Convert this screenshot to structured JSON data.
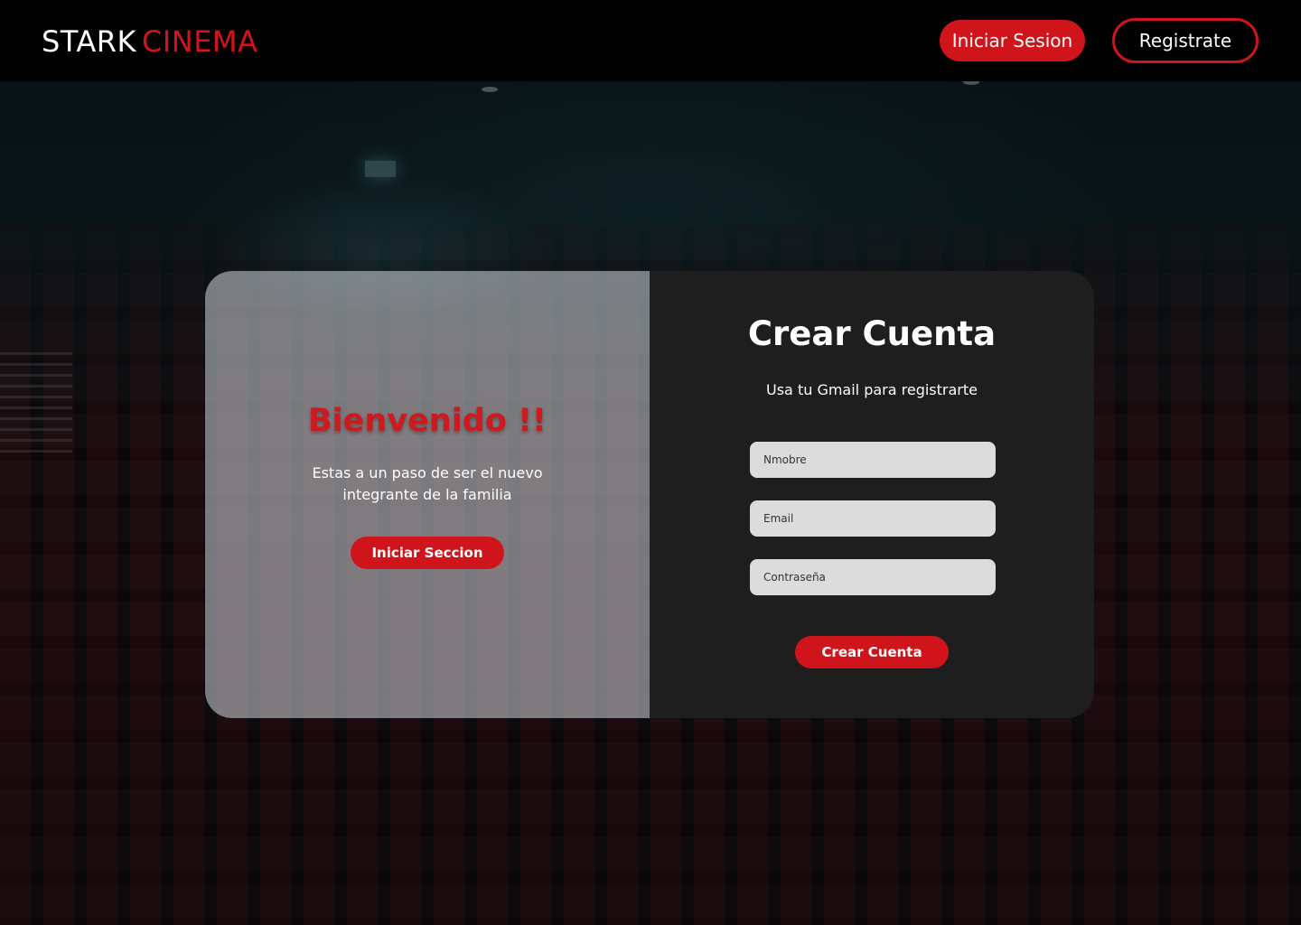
{
  "header": {
    "logo_part1": "STARK",
    "logo_part2": "CINEMA",
    "login_label": "Iniciar Sesion",
    "register_label": "Registrate"
  },
  "welcome": {
    "title": "Bienvenido !!",
    "text": "Estas a un paso de ser el nuevo integrante de la familia",
    "button_label": "Iniciar Seccion"
  },
  "form": {
    "title": "Crear Cuenta",
    "subtitle": "Usa tu Gmail para registrarte",
    "name_placeholder": "Nmobre",
    "email_placeholder": "Email",
    "password_placeholder": "Contraseña",
    "submit_label": "Crear Cuenta"
  },
  "colors": {
    "brand_red": "#d0141c",
    "header_bg": "#000000",
    "card_right_bg": "#1e1e1e"
  }
}
